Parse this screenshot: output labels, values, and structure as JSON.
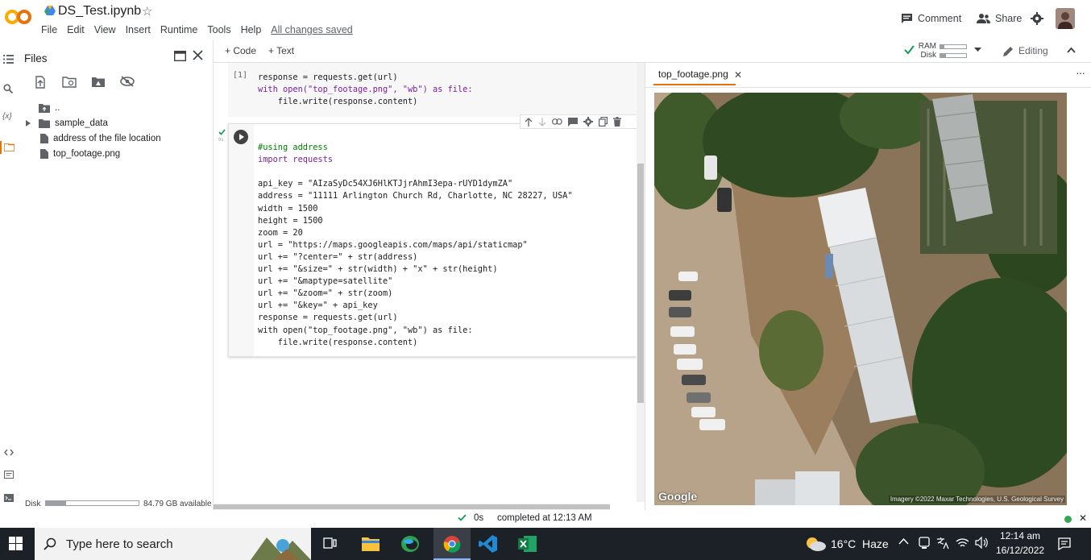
{
  "header": {
    "title": "DS_Test.ipynb",
    "menu": [
      "File",
      "Edit",
      "View",
      "Insert",
      "Runtime",
      "Tools",
      "Help"
    ],
    "saved_status": "All changes saved",
    "comment_label": "Comment",
    "share_label": "Share"
  },
  "toolbar": {
    "code_label": "+ Code",
    "text_label": "+ Text",
    "ram_label": "RAM",
    "disk_label": "Disk",
    "editing_label": "Editing"
  },
  "files_panel": {
    "title": "Files",
    "tree": [
      {
        "name": "..",
        "type": "parent"
      },
      {
        "name": "sample_data",
        "type": "folder"
      },
      {
        "name": "address of the file location",
        "type": "file"
      },
      {
        "name": "top_footage.png",
        "type": "file"
      }
    ],
    "disk_label": "Disk",
    "disk_available": "84.79 GB available",
    "disk_used_fraction": 0.22
  },
  "cells": {
    "cell1": {
      "exec_count": "[1]",
      "lines": [
        "response = requests.get(url)",
        "with open(\"top_footage.png\", \"wb\") as file:",
        "    file.write(response.content)"
      ]
    },
    "cell2": {
      "status_time": "0s",
      "comment": "#using address",
      "lines": [
        "#using address",
        "import requests",
        "",
        "api_key = \"AIzaSyDc54XJ6HlKTJjrAhmI3epa-rUYD1dymZA\"",
        "address = \"11111 Arlington Church Rd, Charlotte, NC 28227, USA\"",
        "width = 1500",
        "height = 1500",
        "zoom = 20",
        "url = \"https://maps.googleapis.com/maps/api/staticmap\"",
        "url += \"?center=\" + str(address)",
        "url += \"&size=\" + str(width) + \"x\" + str(height)",
        "url += \"&maptype=satellite\"",
        "url += \"&zoom=\" + str(zoom)",
        "url += \"&key=\" + api_key",
        "response = requests.get(url)",
        "with open(\"top_footage.png\", \"wb\") as file:",
        "    file.write(response.content)"
      ]
    }
  },
  "image_pane": {
    "tab_label": "top_footage.png",
    "google_watermark": "Google",
    "attribution": "Imagery ©2022 Maxar Technologies, U.S. Geological Survey"
  },
  "status": {
    "time": "0s",
    "message": "completed at 12:13 AM"
  },
  "taskbar": {
    "search_placeholder": "Type here to search",
    "weather_temp": "16°C",
    "weather_desc": "Haze",
    "clock_time": "12:14 am",
    "clock_date": "16/12/2022"
  },
  "colors": {
    "accent_orange": "#F9AB00",
    "ok_green": "#0F9D58",
    "taskbar": "#1C2027"
  }
}
